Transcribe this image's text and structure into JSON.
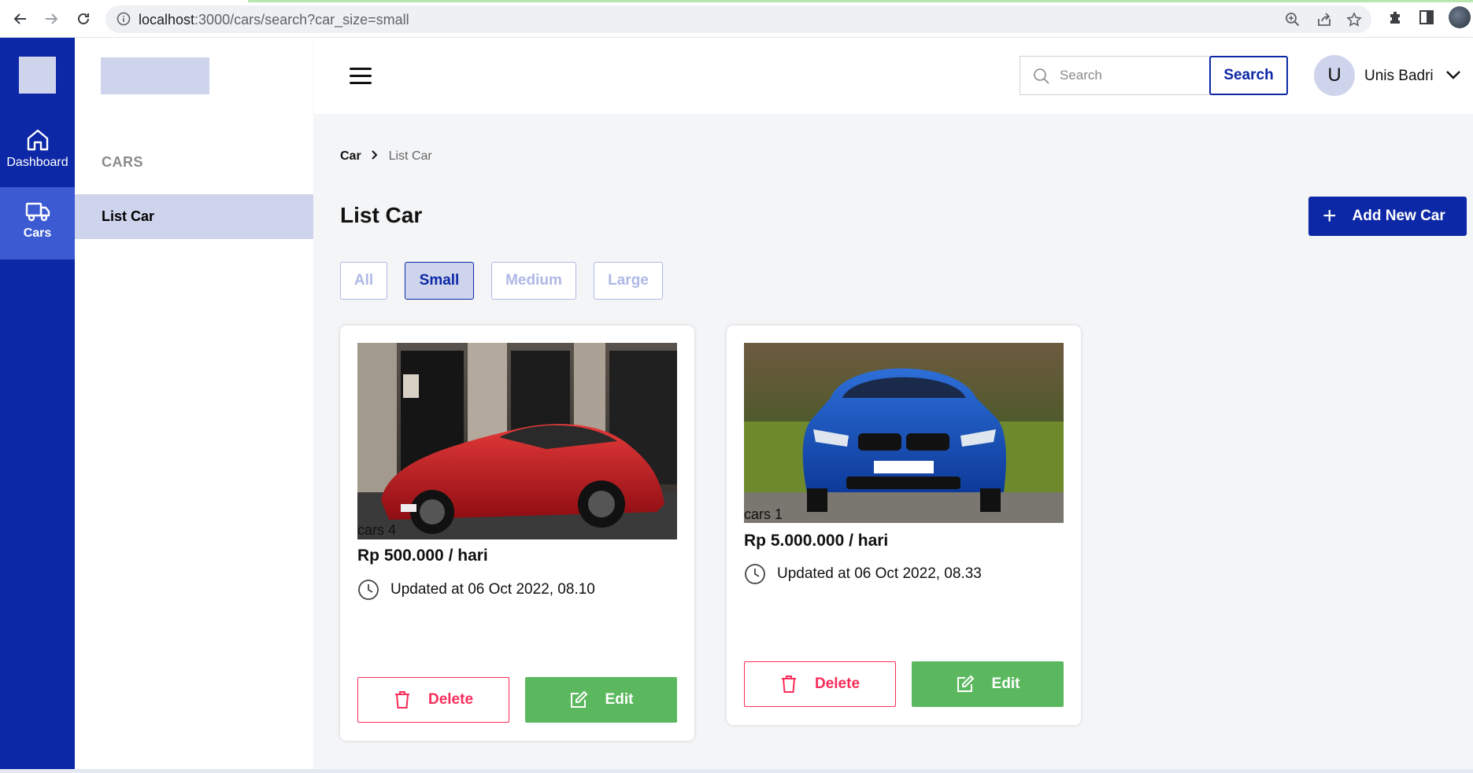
{
  "browser": {
    "url_host": "localhost",
    "url_path": ":3000/cars/search?car_size=small"
  },
  "rail": {
    "items": [
      {
        "label": "Dashboard",
        "icon": "home-icon"
      },
      {
        "label": "Cars",
        "icon": "truck-icon"
      }
    ]
  },
  "sidepanel": {
    "section": "CARS",
    "items": [
      {
        "label": "List Car"
      }
    ]
  },
  "header": {
    "search_placeholder": "Search",
    "search_button": "Search",
    "avatar_initial": "U",
    "username": "Unis Badri"
  },
  "breadcrumb": {
    "root": "Car",
    "current": "List Car"
  },
  "page": {
    "title": "List Car",
    "add_button": "Add New Car"
  },
  "filters": [
    {
      "label": "All",
      "active": false
    },
    {
      "label": "Small",
      "active": true
    },
    {
      "label": "Medium",
      "active": false
    },
    {
      "label": "Large",
      "active": false
    }
  ],
  "cars": [
    {
      "name": "cars 4",
      "price": "Rp 500.000 / hari",
      "updated": "Updated at 06 Oct 2022, 08.10",
      "delete_label": "Delete",
      "edit_label": "Edit",
      "image": "red sports car photo"
    },
    {
      "name": "cars 1",
      "price": "Rp 5.000.000 / hari",
      "updated": "Updated at 06 Oct 2022, 08.33",
      "delete_label": "Delete",
      "edit_label": "Edit",
      "image": "blue sedan photo"
    }
  ],
  "colors": {
    "primary": "#0d28a6",
    "primary_light": "#cfd4ed",
    "danger": "#fa2c5a",
    "success": "#5cb85f",
    "background": "#f4f5f7"
  }
}
